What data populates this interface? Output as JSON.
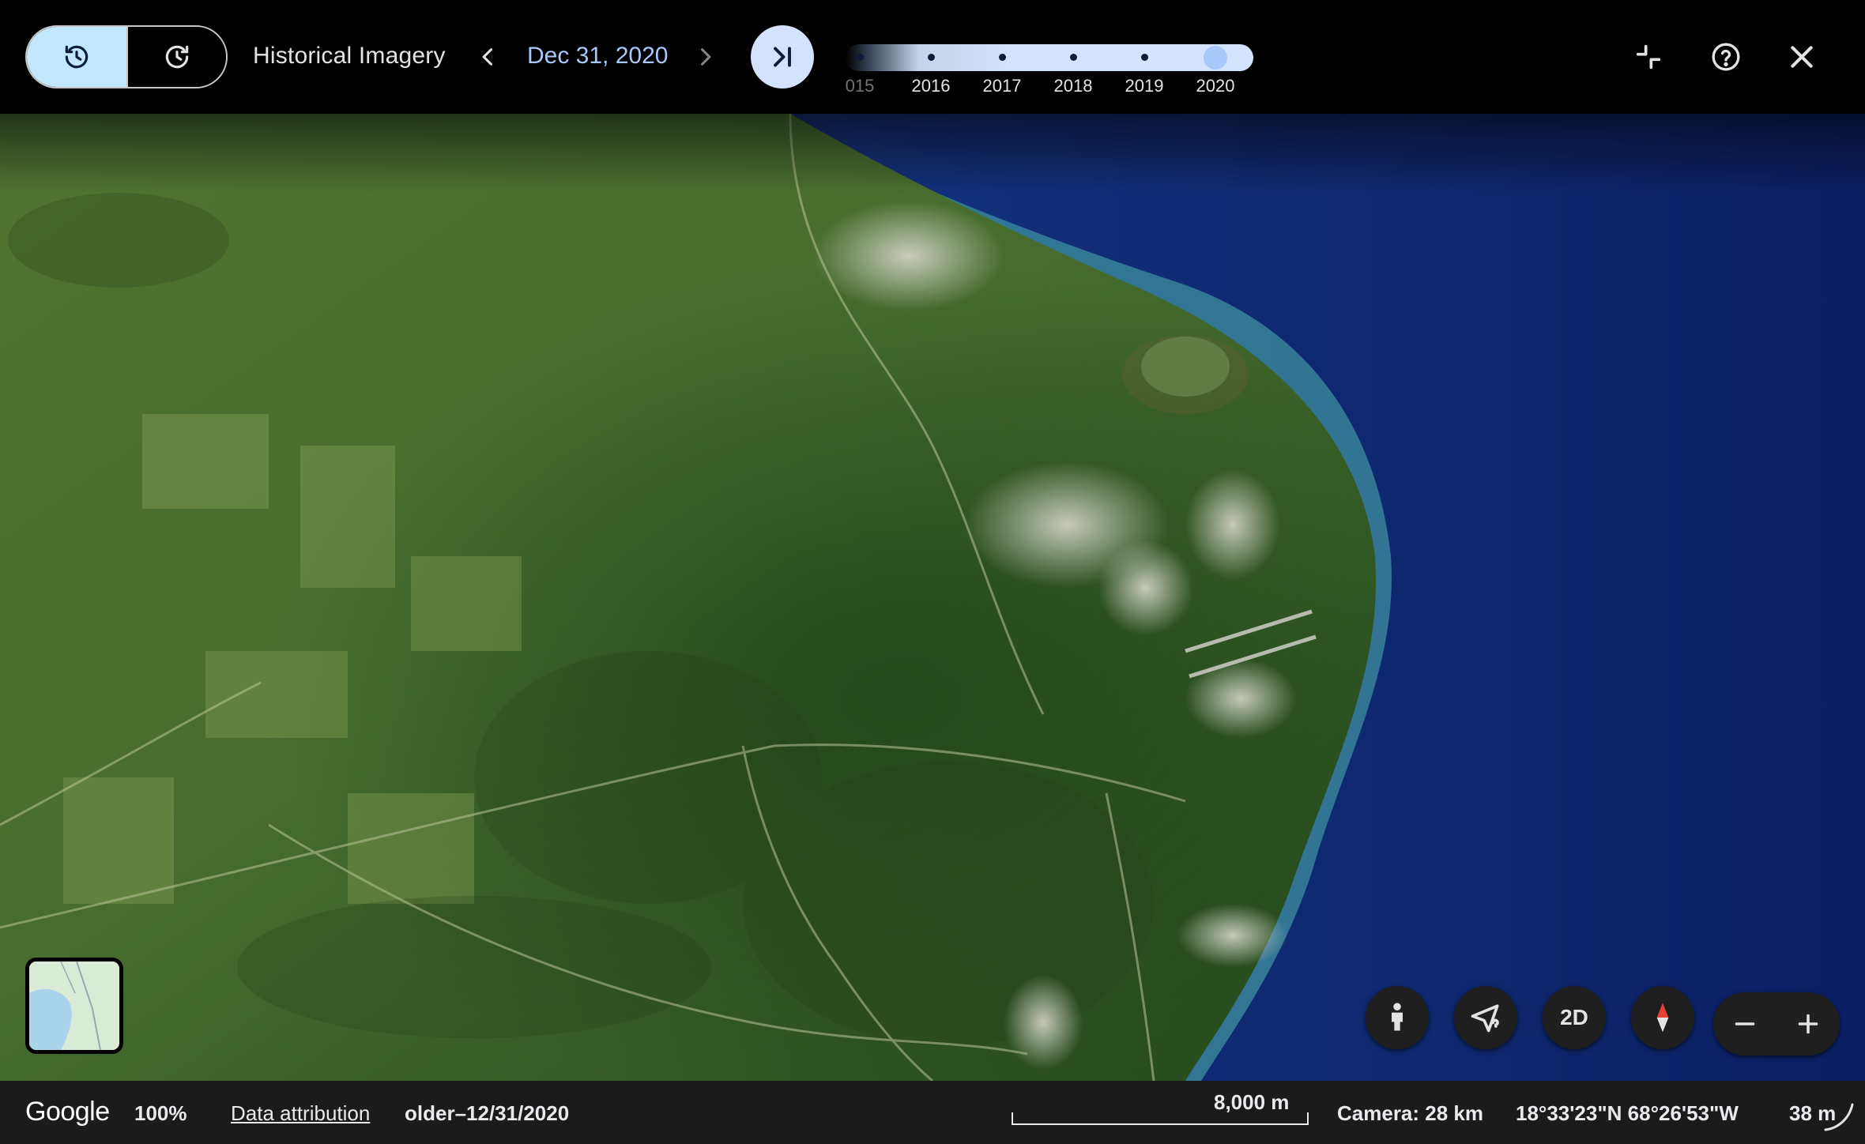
{
  "toolbar": {
    "title": "Historical Imagery",
    "date": "Dec 31, 2020",
    "timeline_years": [
      "015",
      "2016",
      "2017",
      "2018",
      "2019",
      "2020"
    ],
    "selected_year": "2020",
    "icons": {
      "history": "history-icon",
      "restore": "restore-icon",
      "prev": "chevron-left-icon",
      "next": "chevron-right-icon",
      "jump": "skip-to-end-icon",
      "collapse": "collapse-icon",
      "help": "help-icon",
      "close": "close-icon"
    }
  },
  "map_controls": {
    "btn_2d": "2D",
    "icons": [
      "pegman-icon",
      "share-location-icon",
      "compass-icon",
      "zoom-out-icon",
      "zoom-in-icon"
    ]
  },
  "status": {
    "logo": "Google",
    "zoom_percent": "100%",
    "attribution": "Data attribution",
    "date_range": "older–12/31/2020",
    "scale": "8,000 m",
    "camera": "Camera: 28 km",
    "coords": "18°33'23\"N 68°26'53\"W",
    "elevation": "38 m"
  },
  "colors": {
    "accent": "#c2e7ff",
    "date_text": "#a8c7fa",
    "toolbar_bg": "#000000",
    "statusbar_bg": "#1b1b1b"
  }
}
